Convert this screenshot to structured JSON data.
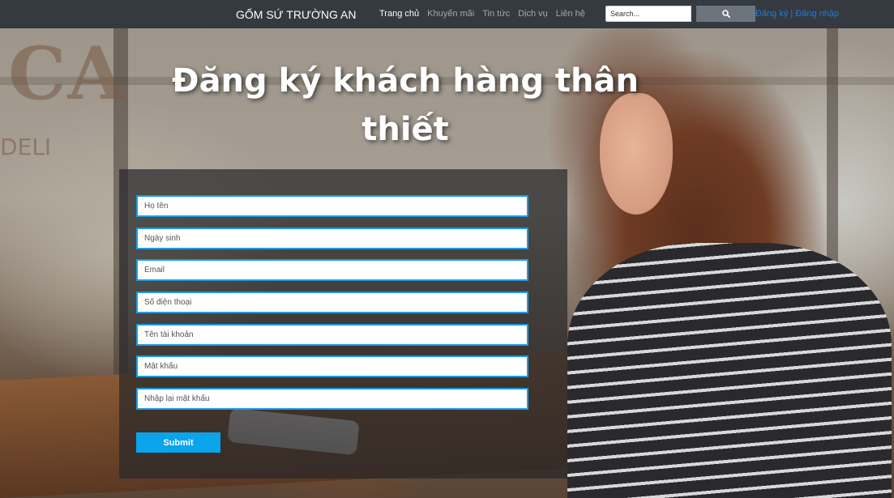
{
  "navbar": {
    "brand": "GỐM SỨ TRƯỜNG AN",
    "menu": [
      {
        "label": "Trang chủ",
        "active": true
      },
      {
        "label": "Khuyến mãi",
        "active": false
      },
      {
        "label": "Tin tức",
        "active": false
      },
      {
        "label": "Dịch vụ",
        "active": false
      },
      {
        "label": "Liên hệ",
        "active": false
      }
    ],
    "search": {
      "placeholder": "Search...",
      "button_icon": "search-icon"
    },
    "auth": {
      "register": "Đăng ký",
      "separator": " | ",
      "login": "Đăng nhập"
    }
  },
  "page": {
    "title": "Đăng ký khách hàng thân thiết"
  },
  "form": {
    "fields": {
      "full_name": "Họ tên",
      "birthday": "Ngày sinh",
      "email": "Email",
      "phone": "Số điện thoại",
      "username": "Tên tài khoản",
      "password": "Mật khẩu",
      "confirm_password": "Nhập lại mật khẩu"
    },
    "submit_label": "Submit"
  },
  "background": {
    "sign_text": "CA",
    "sign_sub_text": "DELI"
  },
  "colors": {
    "navbar_bg": "#343a40",
    "accent": "#0aa4ec",
    "field_border": "#1a9be8",
    "link": "#1f7ae0"
  }
}
